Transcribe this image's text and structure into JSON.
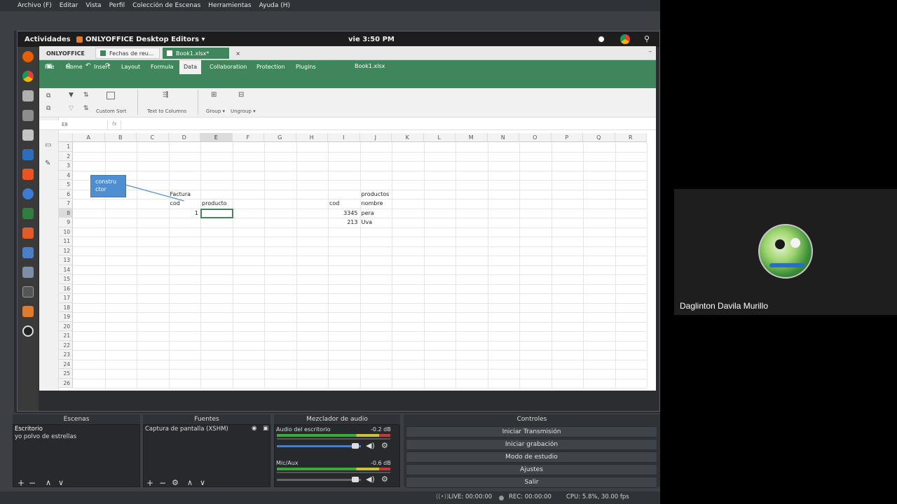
{
  "obs_menu": [
    "Archivo (F)",
    "Editar",
    "Vista",
    "Perfil",
    "Colección de Escenas",
    "Herramientas",
    "Ayuda (H)"
  ],
  "gnome": {
    "activities": "Actividades",
    "app": "ONLYOFFICE Desktop Editors ▾",
    "clock": "vie  3:50 PM"
  },
  "onlyoffice": {
    "tabs": [
      "ONLYOFFICE",
      "Fechas de reu...",
      "Book1.xlsx*"
    ],
    "doc_title": "Book1.xlsx",
    "menu": [
      "File",
      "Home",
      "Insert",
      "Layout",
      "Formula",
      "Data",
      "Collaboration",
      "Protection",
      "Plugins"
    ],
    "active_menu": "Data",
    "toolbar": {
      "custom_sort": "Custom Sort",
      "text_to_columns": "Text to Columns",
      "group": "Group ▾",
      "ungroup": "Ungroup ▾"
    },
    "cell_ref": "E8",
    "fx": "fx"
  },
  "sheet": {
    "columns": [
      "A",
      "B",
      "C",
      "D",
      "E",
      "F",
      "G",
      "H",
      "I",
      "J",
      "K",
      "L",
      "M",
      "N",
      "O",
      "P",
      "Q",
      "R"
    ],
    "rows": [
      "1",
      "2",
      "3",
      "4",
      "5",
      "6",
      "7",
      "8",
      "9",
      "10",
      "11",
      "12",
      "13",
      "14",
      "15",
      "16",
      "17",
      "18",
      "19",
      "20",
      "21",
      "22",
      "23",
      "24",
      "25",
      "26"
    ],
    "shape_text": [
      "constru",
      "ctor"
    ],
    "cells": {
      "D6": "Factura",
      "D7": "cod",
      "E7": "producto",
      "D8": "1",
      "J6": "productos",
      "I7": "cod",
      "J7": "nombre",
      "I8": "3345",
      "J8": "pera",
      "I9": "213",
      "J9": "Uva"
    }
  },
  "obs": {
    "scenes_title": "Escenas",
    "scenes": [
      "Escritorio",
      "yo polvo de estrellas"
    ],
    "sources_title": "Fuentes",
    "sources": [
      "Captura de pantalla (XSHM)"
    ],
    "mixer_title": "Mezclador de audio",
    "mixer": [
      {
        "name": "Audio del escritorio",
        "db": "-0.2 dB"
      },
      {
        "name": "Mic/Aux",
        "db": "-0.6 dB"
      }
    ],
    "controls_title": "Controles",
    "controls": [
      "Iniciar Transmisión",
      "Iniciar grabación",
      "Modo de estudio",
      "Ajustes",
      "Salir"
    ],
    "status": {
      "live": "LIVE: 00:00:00",
      "rec": "REC: 00:00:00",
      "cpu": "CPU: 5.8%, 30.00 fps"
    }
  },
  "participant": {
    "name": "Daglinton Davila Murillo"
  }
}
